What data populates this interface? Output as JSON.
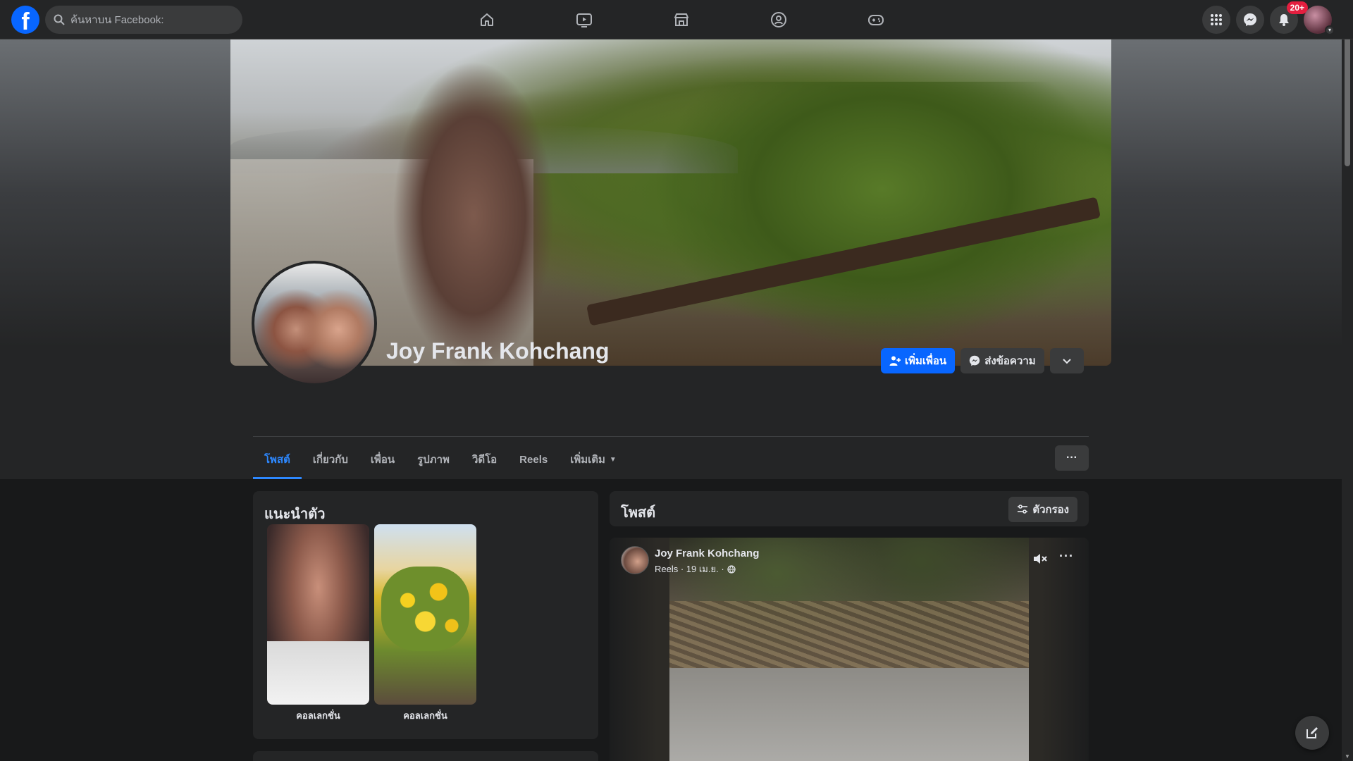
{
  "topbar": {
    "logo_letter": "f",
    "search": {
      "placeholder": "ค้นหาบน Facebook:"
    },
    "nav": [
      {
        "name": "home",
        "icon": "home-icon"
      },
      {
        "name": "watch",
        "icon": "video-icon"
      },
      {
        "name": "marketplace",
        "icon": "store-icon"
      },
      {
        "name": "groups",
        "icon": "groups-icon"
      },
      {
        "name": "gaming",
        "icon": "gamepad-icon"
      }
    ],
    "notifications_badge": "20+"
  },
  "profile": {
    "name": "Joy Frank Kohchang",
    "actions": {
      "add_friend": "เพิ่มเพื่อน",
      "message": "ส่งข้อความ"
    },
    "tabs": [
      "โพสต์",
      "เกี่ยวกับ",
      "เพื่อน",
      "รูปภาพ",
      "วิดีโอ",
      "Reels",
      "เพิ่มเติม"
    ],
    "active_tab": "โพสต์",
    "more_dots": "···"
  },
  "intro": {
    "title": "แนะนำตัว",
    "highlights": [
      {
        "label": "คอลเลกชั่น"
      },
      {
        "label": "คอลเลกชั่น"
      }
    ]
  },
  "posts": {
    "title": "โพสต์",
    "filter_label": "ตัวกรอง",
    "items": [
      {
        "author": "Joy Frank Kohchang",
        "meta": "Reels · 19 เม.ย. ·",
        "dots": "···"
      }
    ]
  },
  "colors": {
    "accent": "#0866ff",
    "active_tab": "#2d88ff",
    "badge": "#e41e3f",
    "surface": "#242526",
    "background": "#18191a"
  }
}
